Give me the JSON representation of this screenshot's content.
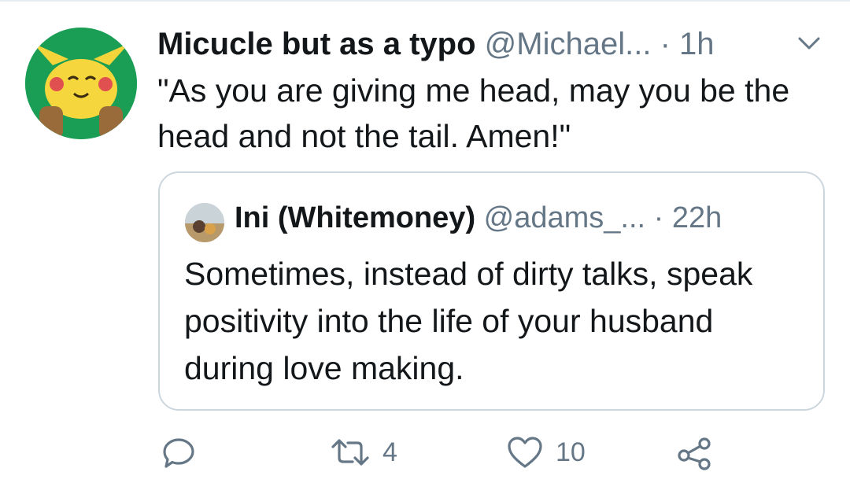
{
  "tweet": {
    "display_name": "Micucle but as a typo",
    "handle": "@Michael...",
    "separator": "·",
    "time": "1h",
    "text": "\"As you are giving me head, may you be the head and not the tail. Amen!\""
  },
  "quoted_tweet": {
    "display_name": "Ini (Whitemoney)",
    "handle": "@adams_...",
    "separator": "·",
    "time": "22h",
    "text": "Sometimes, instead of dirty talks, speak positivity into the life of your husband during love making."
  },
  "actions": {
    "reply_icon": "reply-icon",
    "retweet_icon": "retweet-icon",
    "retweet_count": "4",
    "like_icon": "heart-icon",
    "like_count": "10",
    "share_icon": "share-icon"
  },
  "colors": {
    "text_primary": "#14171a",
    "text_secondary": "#657786",
    "border": "#ccd6dd"
  }
}
